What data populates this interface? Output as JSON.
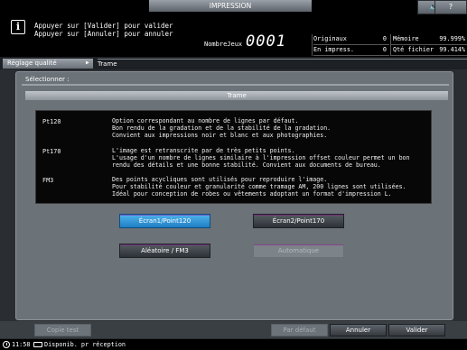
{
  "header": {
    "title": "IMPRESSION",
    "message_line1": "Appuyer sur [Valider] pour valider",
    "message_line2": "Appuyer sur [Annuler] pour annuler",
    "count_label": "NombreJeux",
    "count_value": "0001",
    "speaker_icon": "speaker-icon",
    "help_label": "?",
    "stats": {
      "originals_label": "Originaux",
      "originals_value": "0",
      "memory_label": "Mémoire",
      "memory_value": "99.999%",
      "in_print_label": "En impress.",
      "in_print_value": "0",
      "file_qty_label": "Qté fichier",
      "file_qty_value": "99.414%"
    }
  },
  "breadcrumb": {
    "item1": "Réglage qualité",
    "item2": "Trame"
  },
  "panel": {
    "select_label": "Sélectionner :",
    "section_title": "Trame",
    "descriptions": [
      {
        "key": "Pt120",
        "text": "Option correspondant au nombre de lignes par défaut.\nBon rendu de la gradation et de la stabilité de la gradation.\nConvient aux impressions noir et blanc et aux photographies."
      },
      {
        "key": "Pt170",
        "text": "L'image est retranscrite par de très petits points.\nL'usage d'un nombre de lignes similaire à l'impression offset couleur permet un bon\nrendu des détails et une bonne stabilité. Convient aux documents de bureau."
      },
      {
        "key": "FM3",
        "text": "Des points acycliques sont utilisés pour reproduire l'image.\nPour stabilité couleur et granularité comme tramage AM, 200 lignes sont utilisées.\nIdéal pour conception de robes ou vêtements adoptant un format d'impression L."
      }
    ],
    "buttons": {
      "screen1": "Écran1/Point120",
      "screen2": "Écran2/Point170",
      "random": "Aléatoire / FM3",
      "auto": "Automatique"
    }
  },
  "actions": {
    "test_copy": "Copie test",
    "default": "Par défaut",
    "cancel": "Annuler",
    "confirm": "Valider"
  },
  "status": {
    "time": "11:58",
    "state": "Disponib. pr réception"
  }
}
